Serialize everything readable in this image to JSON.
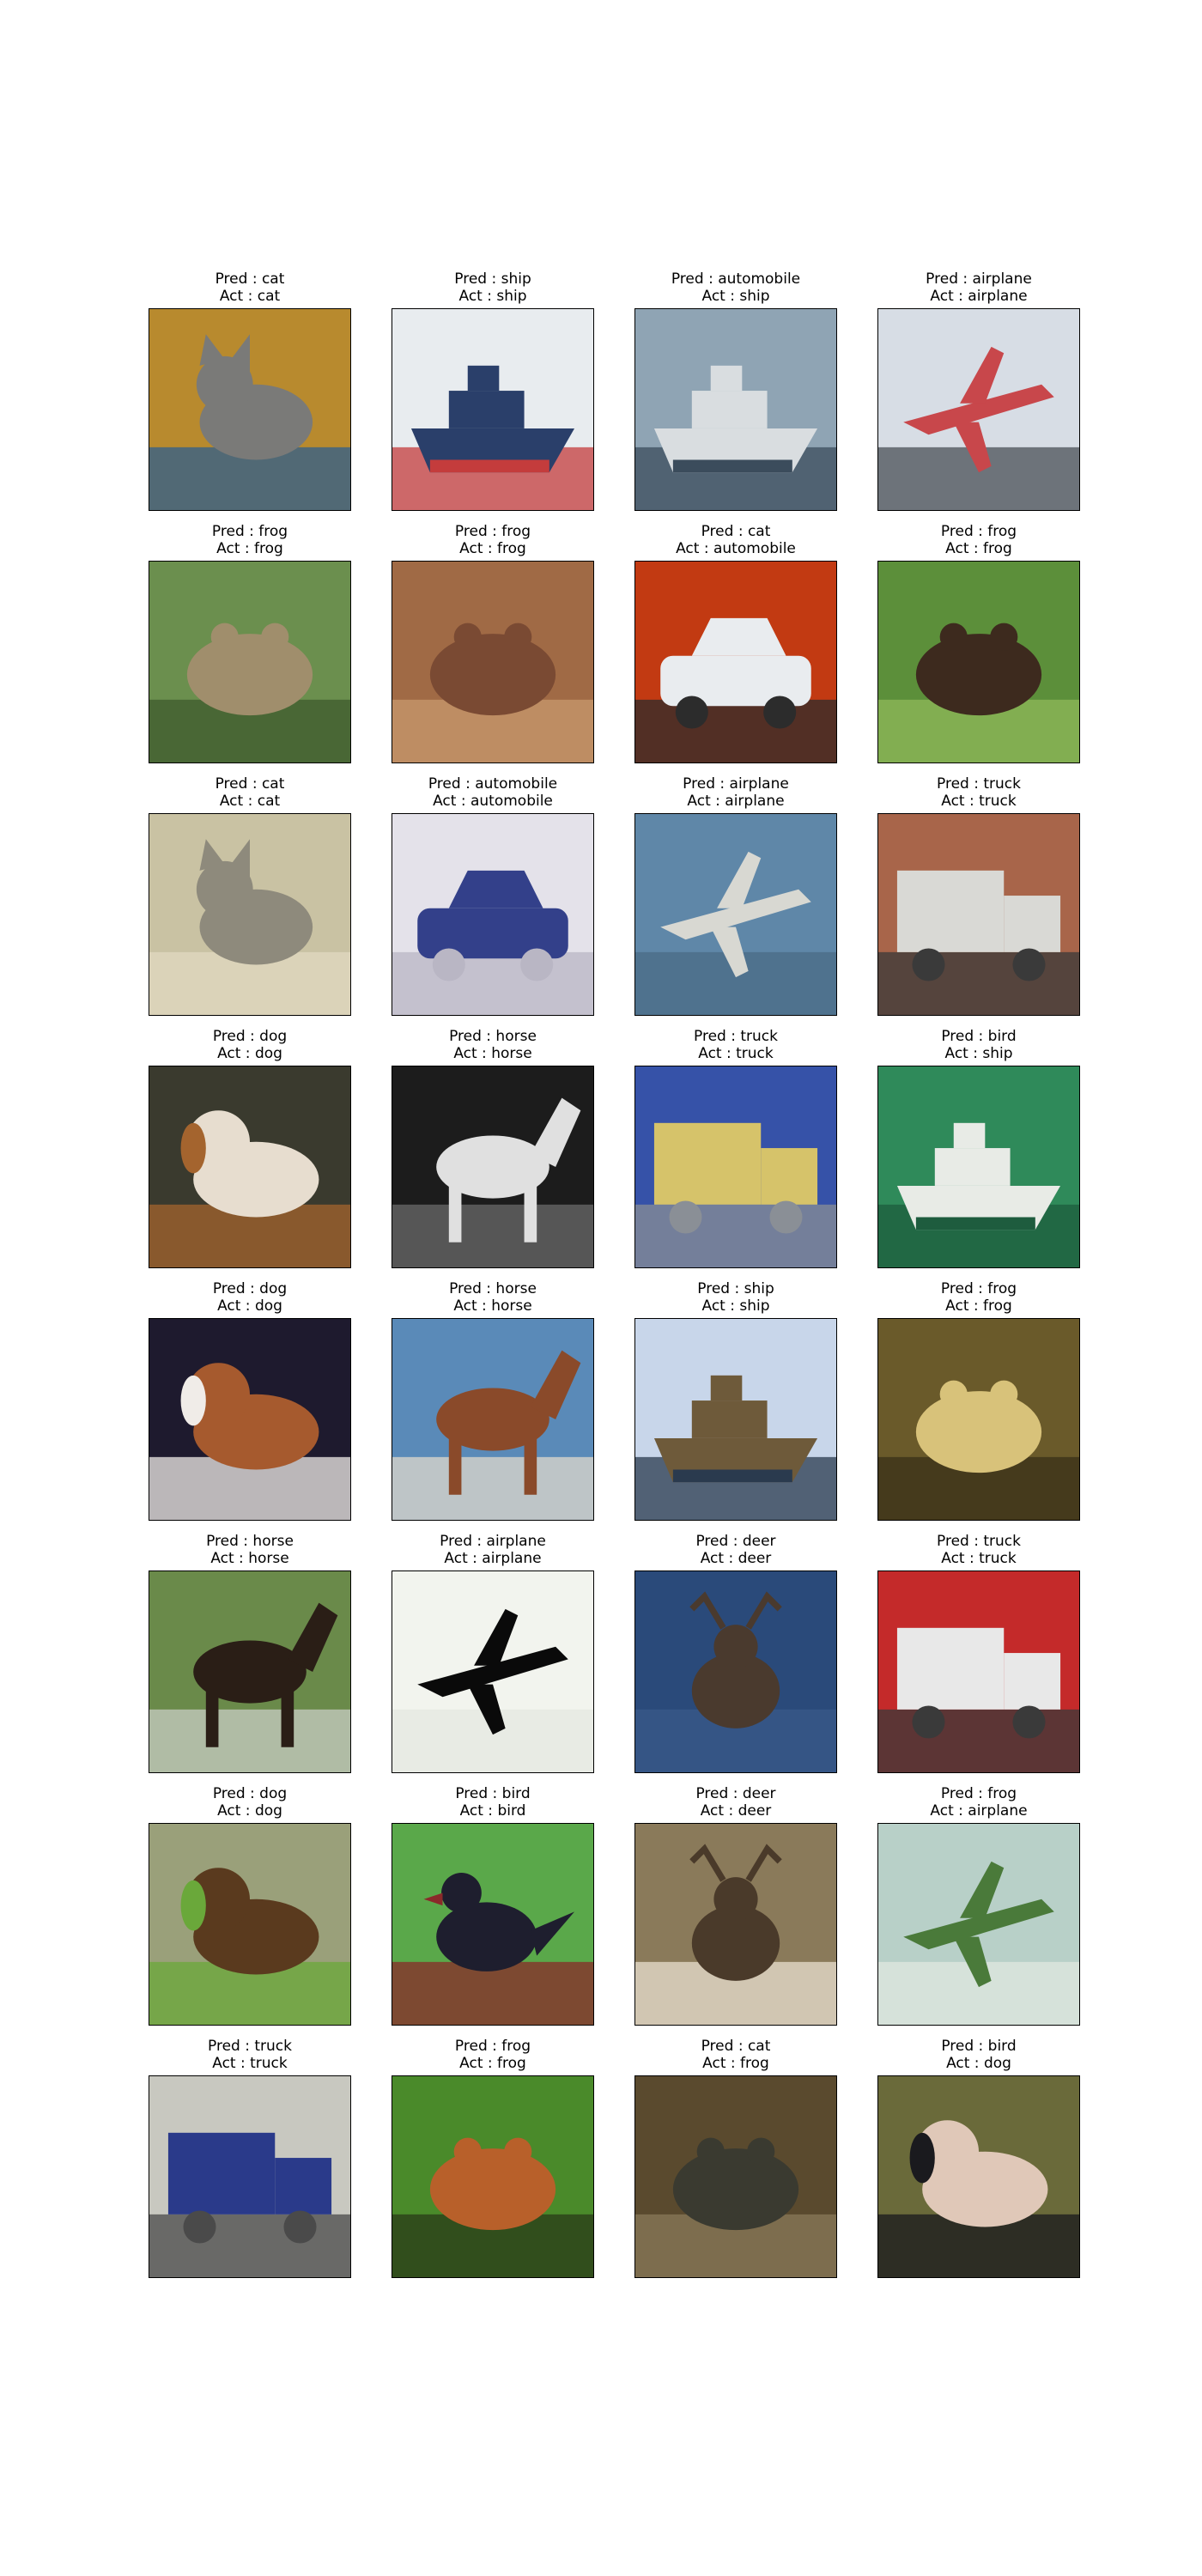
{
  "images": [
    {
      "pred": "Pred : cat",
      "act": "Act : cat",
      "icon": "cat-photo",
      "colors": [
        "#b88a2e",
        "#7a7a78",
        "#2f5d8e"
      ]
    },
    {
      "pred": "Pred : ship",
      "act": "Act : ship",
      "icon": "ship-photo",
      "colors": [
        "#e8ecef",
        "#2a3f6a",
        "#c43c3c"
      ]
    },
    {
      "pred": "Pred : automobile",
      "act": "Act : ship",
      "icon": "ship-photo",
      "colors": [
        "#8fa4b4",
        "#d9dde0",
        "#3b4c5c"
      ]
    },
    {
      "pred": "Pred : airplane",
      "act": "Act : airplane",
      "icon": "airplane-photo",
      "colors": [
        "#d7dde5",
        "#c8474b",
        "#4a4f55"
      ]
    },
    {
      "pred": "Pred : frog",
      "act": "Act : frog",
      "icon": "frog-photo",
      "colors": [
        "#6b8f4e",
        "#a08e6c",
        "#3d5a2e"
      ]
    },
    {
      "pred": "Pred : frog",
      "act": "Act : frog",
      "icon": "frog-photo",
      "colors": [
        "#a06a45",
        "#7a4a33",
        "#c89a6d"
      ]
    },
    {
      "pred": "Pred : cat",
      "act": "Act : automobile",
      "icon": "automobile-photo",
      "colors": [
        "#c23a12",
        "#e9ecef",
        "#2c2c2c"
      ]
    },
    {
      "pred": "Pred : frog",
      "act": "Act : frog",
      "icon": "frog-photo",
      "colors": [
        "#5c8f3a",
        "#3d2a1e",
        "#8fb85a"
      ]
    },
    {
      "pred": "Pred : cat",
      "act": "Act : cat",
      "icon": "cat-photo",
      "colors": [
        "#c9c2a3",
        "#8e8a7c",
        "#e0d8c0"
      ]
    },
    {
      "pred": "Pred : automobile",
      "act": "Act : automobile",
      "icon": "automobile-photo",
      "colors": [
        "#e4e2ea",
        "#33408a",
        "#b9b6c4"
      ]
    },
    {
      "pred": "Pred : airplane",
      "act": "Act : airplane",
      "icon": "airplane-photo",
      "colors": [
        "#5f87a8",
        "#d8d8d2",
        "#4a6b85"
      ]
    },
    {
      "pred": "Pred : truck",
      "act": "Act : truck",
      "icon": "truck-photo",
      "colors": [
        "#a8654a",
        "#d9d9d5",
        "#3a3a3a"
      ]
    },
    {
      "pred": "Pred : dog",
      "act": "Act : dog",
      "icon": "dog-photo",
      "colors": [
        "#3a3a2e",
        "#e7ddcf",
        "#a4642e"
      ]
    },
    {
      "pred": "Pred : horse",
      "act": "Act : horse",
      "icon": "horse-photo",
      "colors": [
        "#1c1c1c",
        "#e0e0e0",
        "#6a6a6a"
      ]
    },
    {
      "pred": "Pred : truck",
      "act": "Act : truck",
      "icon": "truck-photo",
      "colors": [
        "#3652a8",
        "#d6c36a",
        "#8a8f96"
      ]
    },
    {
      "pred": "Pred : bird",
      "act": "Act : ship",
      "icon": "ship-photo",
      "colors": [
        "#2f8a5a",
        "#e8ebe6",
        "#1e5c3e"
      ]
    },
    {
      "pred": "Pred : dog",
      "act": "Act : dog",
      "icon": "dog-photo",
      "colors": [
        "#1e1a2e",
        "#a65a2e",
        "#f0ece8"
      ]
    },
    {
      "pred": "Pred : horse",
      "act": "Act : horse",
      "icon": "horse-photo",
      "colors": [
        "#5a8ab8",
        "#8a4a2a",
        "#e0d8cc"
      ]
    },
    {
      "pred": "Pred : ship",
      "act": "Act : ship",
      "icon": "ship-photo",
      "colors": [
        "#c8d6ea",
        "#6e5a3a",
        "#2a3a4e"
      ]
    },
    {
      "pred": "Pred : frog",
      "act": "Act : frog",
      "icon": "frog-photo",
      "colors": [
        "#6a5a2a",
        "#d8c27a",
        "#3a3018"
      ]
    },
    {
      "pred": "Pred : horse",
      "act": "Act : horse",
      "icon": "horse-photo",
      "colors": [
        "#6a8a4a",
        "#2a1e16",
        "#c8ccc4"
      ]
    },
    {
      "pred": "Pred : airplane",
      "act": "Act : airplane",
      "icon": "airplane-photo",
      "colors": [
        "#f2f4ee",
        "#0a0a0a",
        "#e4e8e0"
      ]
    },
    {
      "pred": "Pred : deer",
      "act": "Act : deer",
      "icon": "deer-photo",
      "colors": [
        "#2a4a7a",
        "#4a3a2e",
        "#3a5a8a"
      ]
    },
    {
      "pred": "Pred : truck",
      "act": "Act : truck",
      "icon": "truck-photo",
      "colors": [
        "#c42a2a",
        "#e8e8e8",
        "#3a3a3a"
      ]
    },
    {
      "pred": "Pred : dog",
      "act": "Act : dog",
      "icon": "dog-photo",
      "colors": [
        "#9aa07a",
        "#5a3a1e",
        "#6aa83a"
      ]
    },
    {
      "pred": "Pred : bird",
      "act": "Act : bird",
      "icon": "bird-photo",
      "colors": [
        "#5aa84a",
        "#1e1e2e",
        "#8a2a2a"
      ]
    },
    {
      "pred": "Pred : deer",
      "act": "Act : deer",
      "icon": "deer-photo",
      "colors": [
        "#8a7a5a",
        "#4a3a2a",
        "#e8e0d0"
      ]
    },
    {
      "pred": "Pred : frog",
      "act": "Act : airplane",
      "icon": "airplane-photo",
      "colors": [
        "#b8d0c8",
        "#4a7a3a",
        "#e0e8e0"
      ]
    },
    {
      "pred": "Pred : truck",
      "act": "Act : truck",
      "icon": "truck-photo",
      "colors": [
        "#c8c8c0",
        "#2a3a8a",
        "#4a4a4a"
      ]
    },
    {
      "pred": "Pred : frog",
      "act": "Act : frog",
      "icon": "frog-photo",
      "colors": [
        "#4a8a2a",
        "#b8602a",
        "#2a3a18"
      ]
    },
    {
      "pred": "Pred : cat",
      "act": "Act : frog",
      "icon": "frog-photo",
      "colors": [
        "#5a4a2e",
        "#3a3a30",
        "#8a7a5a"
      ]
    },
    {
      "pred": "Pred : bird",
      "act": "Act : dog",
      "icon": "dog-photo",
      "colors": [
        "#6a6a3a",
        "#e0c8b8",
        "#1a1a1e"
      ]
    }
  ]
}
